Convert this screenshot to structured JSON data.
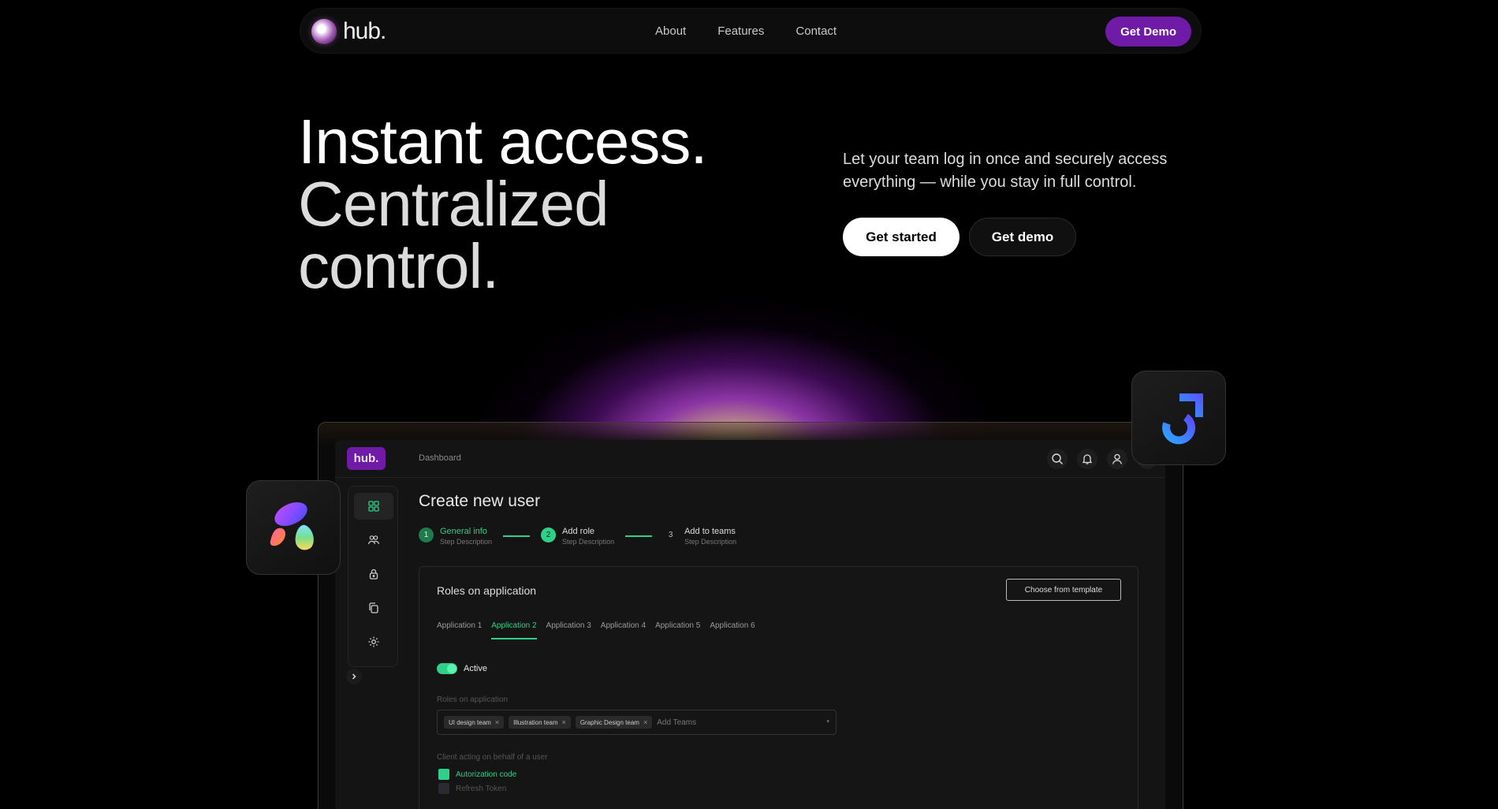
{
  "nav": {
    "logo_text": "hub.",
    "links": [
      "About",
      "Features",
      "Contact"
    ],
    "cta_label": "Get Demo"
  },
  "hero": {
    "title_line1": "Instant access.",
    "title_line2": "Centralized",
    "title_line3": "control.",
    "subtitle": "Let your team log in once and securely access everything — while you stay in full control.",
    "primary_button": "Get started",
    "secondary_button": "Get demo"
  },
  "dashboard": {
    "logo_text": "hub.",
    "breadcrumb": "Dashboard",
    "top_icons": [
      "search-icon",
      "bell-icon",
      "user-icon",
      "sun-icon"
    ],
    "sidebar_icons": [
      "grid-icon",
      "users-icon",
      "lock-icon",
      "copy-icon",
      "gear-icon"
    ],
    "page_title": "Create new user",
    "steps": [
      {
        "num": "1",
        "label": "General info",
        "desc": "Step Description"
      },
      {
        "num": "2",
        "label": "Add role",
        "desc": "Step Description"
      },
      {
        "num": "3",
        "label": "Add to teams",
        "desc": "Step Description"
      }
    ],
    "card": {
      "title": "Roles on application",
      "template_button": "Choose from template",
      "tabs": [
        "Application 1",
        "Application 2",
        "Application 3",
        "Application 4",
        "Application 5",
        "Application 6"
      ],
      "active_tab": "Application 2",
      "toggle_label": "Active",
      "roles_label": "Roles on application",
      "chips": [
        "UI design team",
        "Illustration team",
        "Graphic Design team"
      ],
      "add_placeholder": "Add Teams",
      "client_label": "Client acting on behalf of a user",
      "checks": [
        {
          "label": "Autorization code",
          "checked": true
        },
        {
          "label": "Refresh Token",
          "checked": false
        }
      ]
    }
  },
  "colors": {
    "accent_purple": "#6f1ba8",
    "accent_green": "#2fd08a",
    "background": "#000000"
  }
}
